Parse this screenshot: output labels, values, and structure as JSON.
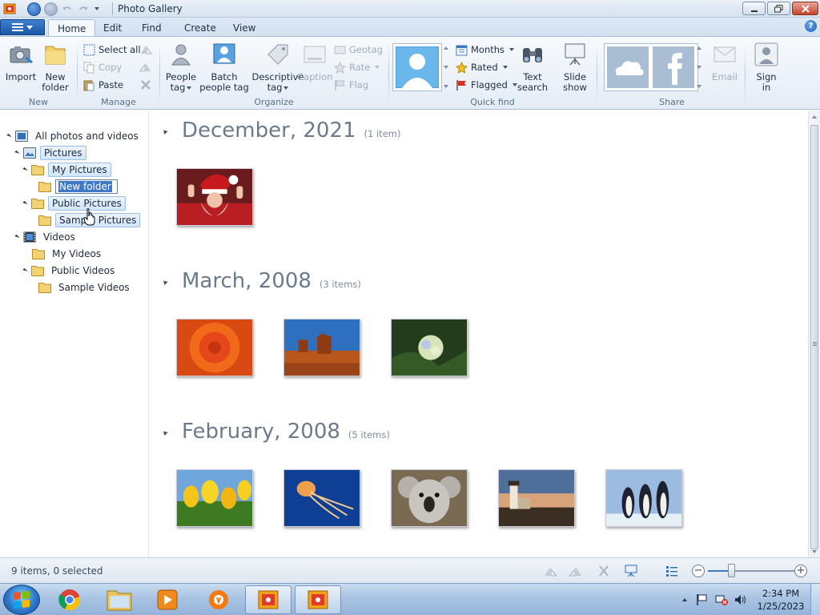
{
  "window": {
    "title": "Photo Gallery"
  },
  "tabs": [
    "Home",
    "Edit",
    "Find",
    "Create",
    "View"
  ],
  "ribbon": {
    "new_group": {
      "label": "New",
      "import": "Import",
      "new_folder_1": "New",
      "new_folder_2": "folder"
    },
    "manage_group": {
      "label": "Manage",
      "select_all": "Select all",
      "copy": "Copy",
      "paste": "Paste"
    },
    "organize_group": {
      "label": "Organize",
      "people_tag_1": "People",
      "people_tag_2": "tag",
      "batch_1": "Batch",
      "batch_2": "people tag",
      "descriptive_1": "Descriptive",
      "descriptive_2": "tag",
      "caption": "Caption",
      "geotag": "Geotag",
      "rate": "Rate",
      "flag": "Flag"
    },
    "quickfind_group": {
      "label": "Quick find",
      "months": "Months",
      "rated": "Rated",
      "flagged": "Flagged",
      "text_search_1": "Text",
      "text_search_2": "search"
    },
    "share_group": {
      "label": "Share",
      "slideshow_1": "Slide",
      "slideshow_2": "show",
      "email": "Email",
      "signin_1": "Sign",
      "signin_2": "in"
    }
  },
  "tree": {
    "all": "All photos and videos",
    "pictures": "Pictures",
    "my_pictures": "My Pictures",
    "new_folder": "New folder",
    "public_pictures": "Public Pictures",
    "sample_pictures": "Sample Pictures",
    "videos": "Videos",
    "my_videos": "My Videos",
    "public_videos": "Public Videos",
    "sample_videos": "Sample Videos"
  },
  "sections": [
    {
      "title": "December, 2021",
      "count": "(1 item)"
    },
    {
      "title": "March, 2008",
      "count": "(3 items)"
    },
    {
      "title": "February, 2008",
      "count": "(5 items)"
    }
  ],
  "status": {
    "text": "9 items, 0 selected",
    "zoom_fraction": 0.28
  },
  "taskbar": {
    "time": "2:34 PM",
    "date": "1/25/2023"
  },
  "colors": {
    "accent": "#1f5fb0",
    "section_title": "#6b7b8c",
    "taskbar": "#a9c4e3"
  }
}
